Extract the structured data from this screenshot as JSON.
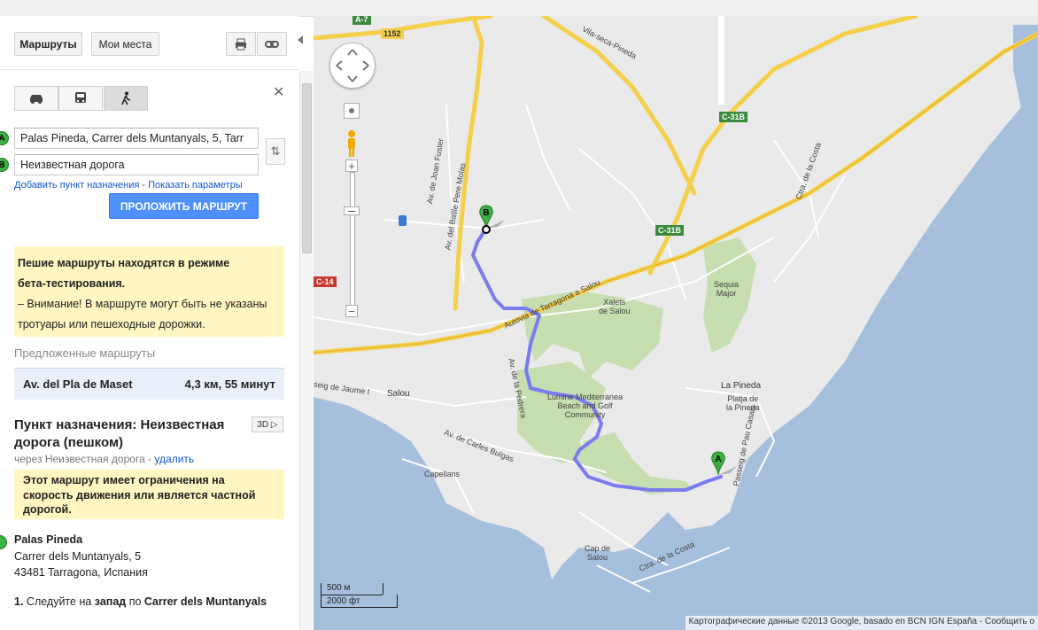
{
  "toolbar": {
    "routes_label": "Маршруты",
    "my_places_label": "Мои места"
  },
  "modes": [
    "car-icon",
    "bus-icon",
    "walk-icon"
  ],
  "directions": {
    "from_marker": "A",
    "to_marker": "B",
    "from_value": "Palas Pineda, Carrer dels Muntanyals, 5, Tarr",
    "to_value": "Неизвестная дорога",
    "add_destination_link": "Добавить пункт назначения",
    "link_separator": " - ",
    "show_options_link": "Показать параметры",
    "route_button": "ПРОЛОЖИТЬ МАРШРУТ",
    "close_symbol": "✕"
  },
  "beta_notice": {
    "title_line1": "Пешие маршруты находятся в режиме",
    "title_line2": "бета-тестирования.",
    "body": "– Внимание! В маршруте могут быть не указаны тротуары или пешеходные дорожки."
  },
  "suggested": {
    "heading": "Предложенные маршруты",
    "route_name": "Av. del Pla de Maset",
    "route_stats": "4,3 км, 55 минут"
  },
  "destination": {
    "title": "Пункт назначения: Неизвестная дорога (пешком)",
    "btn_3d": "3D",
    "via_prefix": "через Неизвестная дорога - ",
    "delete_link": "удалить",
    "restriction_notice": "Этот маршрут имеет ограничения на скорость движения или является частной дорогой."
  },
  "start_address": {
    "name": "Palas Pineda",
    "line1": "Carrer dels Muntanyals, 5",
    "line2": "43481 Tarragona, Испания"
  },
  "step1": {
    "number": "1.",
    "text_a": " Следуйте на ",
    "dir": "запад",
    "text_b": " по ",
    "street": "Carrer dels Muntanyals"
  },
  "map": {
    "labels": {
      "vila_seca": "Vila-seca-Pineda",
      "joan_fuster": "Av. de Joan Fuster",
      "batlle": "Av. del Batlle Pere Molas",
      "autovia": "Autovia de Tarragona a Salou",
      "xalets": "Xalets\nde Salou",
      "sequia": "Sequia\nMajor",
      "la_pineda": "La Pineda",
      "platja": "Platja de\nla Pineda",
      "salou": "Salou",
      "jaume": "seig de Jaume I",
      "pedrera": "Av. de la Pedrera",
      "lumine": "Lumine Mediterranea\nBeach and Golf\nCommunity",
      "carles": "Av. de Carles Buïgas",
      "capellans": "Capellans",
      "cap_salou": "Cap de\nSalou",
      "costa1": "Ctra. de la Costa",
      "costa2": "Ctra. de la Costa",
      "pau_casals": "Passeig de Pau Casals"
    },
    "shields": {
      "s1152": "1152",
      "c31b_1": "C-31B",
      "c31b_2": "C-31B",
      "c14": "C-14",
      "a7": "A-7"
    },
    "scale_m": "500 м",
    "scale_ft": "2000 фт",
    "copyright": "Картографические данные ©2013 Google, basado en BCN IGN España -  Сообщить о"
  },
  "colors": {
    "route": "#7b7bf0",
    "water": "#a5bfdd",
    "green": "#c6deb0",
    "land": "#eaeaea",
    "highway": "#f5d04a",
    "button_blue": "#4d90fe",
    "notice_yellow": "#fff6c1"
  }
}
